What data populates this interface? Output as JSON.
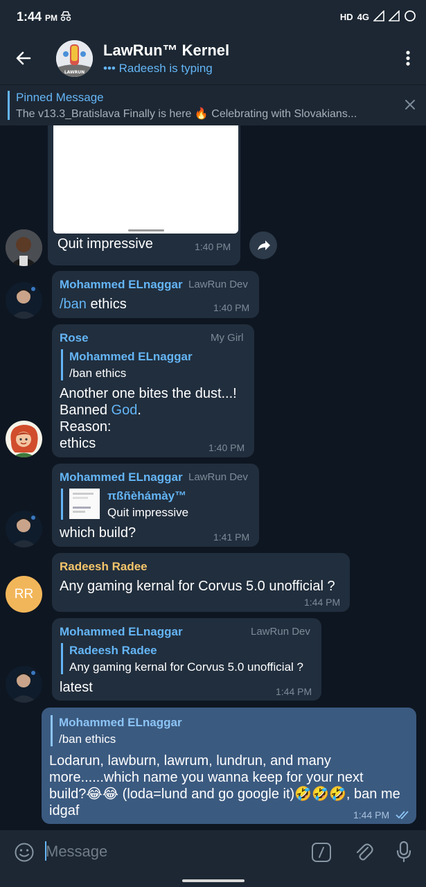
{
  "status_bar": {
    "time": "1:44",
    "ampm": "PM",
    "hd": "HD",
    "network": "4G"
  },
  "header": {
    "title": "LawRun™ Kernel",
    "typing": "Radeesh is typing",
    "avatar_text": "LAWRUN"
  },
  "pinned": {
    "title": "Pinned Message",
    "text": "The v13.3_Bratislava Finally is here 🔥 Celebrating with Slovakians..."
  },
  "messages": [
    {
      "text": "Quit impressive",
      "time": "1:40 PM"
    },
    {
      "sender": "Mohammed ELnaggar",
      "role": "LawRun Dev",
      "cmd": "/ban",
      "text": " ethics",
      "time": "1:40 PM"
    },
    {
      "sender": "Rose",
      "role": "My Girl",
      "quote_name": "Mohammed ELnaggar",
      "quote_text": "/ban ethics",
      "line1": "Another one bites the dust...!",
      "line2_pre": "Banned ",
      "line2_link": "God",
      "line2_post": ".",
      "line3": "Reason:",
      "line4": "ethics",
      "time": "1:40 PM"
    },
    {
      "sender": "Mohammed ELnaggar",
      "role": "LawRun Dev",
      "quote_name": "πßñèhámày™",
      "quote_text": "Quit impressive",
      "text": "which build?",
      "time": "1:41 PM"
    },
    {
      "sender": "Radeesh Radee",
      "avatar_initials": "RR",
      "text": "Any gaming kernal for Corvus 5.0 unofficial ?",
      "time": "1:44 PM"
    },
    {
      "sender": "Mohammed ELnaggar",
      "role": "LawRun Dev",
      "quote_name": "Radeesh Radee",
      "quote_text": "Any gaming kernal for Corvus 5.0 unofficial ?",
      "text": "latest",
      "time": "1:44 PM"
    },
    {
      "quote_name": "Mohammed ELnaggar",
      "quote_text": "/ban ethics",
      "lines": [
        "Lodarun, lawburn, lawrum, lundrun, and many",
        "more......which name you wanna keep for your next",
        "build?😂😂 (loda=lund and go google it)🤣🤣🤣, ban me",
        "idgaf"
      ],
      "time": "1:44 PM"
    }
  ],
  "input": {
    "placeholder": "Message"
  },
  "colors": {
    "bg": "#0e1621",
    "bubble_in": "#212e3d",
    "bubble_out": "#3b5a80",
    "accent": "#64b5f6",
    "rose": "#64b5f6",
    "radeesh": "#f5c56b"
  }
}
